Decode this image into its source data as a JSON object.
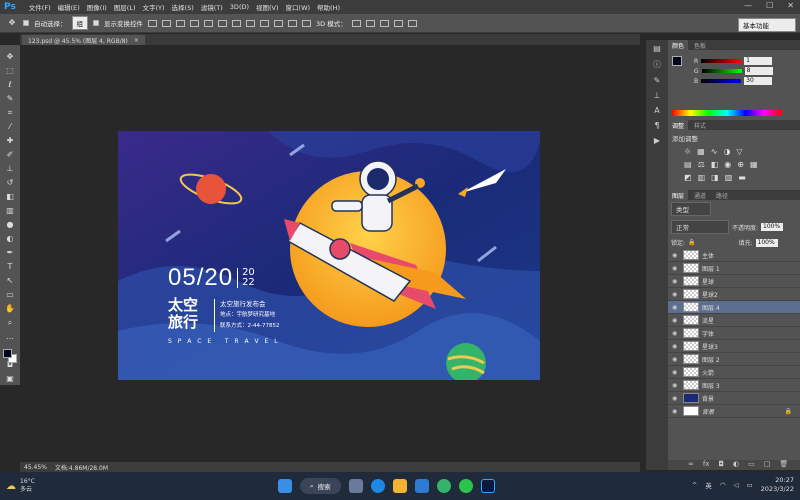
{
  "app": {
    "logo": "Ps"
  },
  "menu": [
    "文件(F)",
    "编辑(E)",
    "图像(I)",
    "图层(L)",
    "文字(Y)",
    "选择(S)",
    "滤镜(T)",
    "3D(D)",
    "视图(V)",
    "窗口(W)",
    "帮助(H)"
  ],
  "window_controls": [
    "—",
    "☐",
    "✕"
  ],
  "options_bar": {
    "auto_select": "自动选择：",
    "auto_select_value": "组",
    "show_transform": "显示变换控件",
    "mode_3d": "3D 模式：",
    "workspace": "基本功能"
  },
  "doc_tab": {
    "title": "123.psd @ 45.5% (图层 4, RGB/8)",
    "close": "×"
  },
  "poster": {
    "date": "05/20",
    "year_top": "20",
    "year_bottom": "22",
    "title_line1": "太空",
    "title_line2": "旅行",
    "event": "太空旅行发布会",
    "address": "地点：宇航梦研究基地",
    "contact": "联系方式：2-44-77852",
    "subtitle": "S P A C E   T R A V E L"
  },
  "status": {
    "zoom": "45.45%",
    "doc": "文档:4.86M/28.0M"
  },
  "color_panel": {
    "tabs": [
      "颜色",
      "色板"
    ],
    "r_label": "R",
    "g_label": "G",
    "b_label": "B",
    "r": "1",
    "g": "8",
    "b": "30",
    "swatch": "#01081e"
  },
  "adjust_panel": {
    "tabs": [
      "调整",
      "样式"
    ],
    "title": "添加调整"
  },
  "layers_panel": {
    "tabs": [
      "图层",
      "通道",
      "路径"
    ],
    "filter": "类型",
    "blend": "正常",
    "opacity_label": "不透明度:",
    "opacity": "100%",
    "lock_label": "锁定:",
    "fill_label": "填充:",
    "fill": "100%",
    "layers": [
      "主体",
      "图层 1",
      "星球",
      "星球2",
      "图层 4",
      "流星",
      "字体",
      "星球3",
      "图层 2",
      "火箭",
      "图层 3",
      "背景",
      "背景"
    ]
  },
  "taskbar": {
    "temp": "16°C",
    "weather": "多云",
    "search": "搜索",
    "ime": "英",
    "time": "20:27",
    "date": "2023/3/22"
  }
}
